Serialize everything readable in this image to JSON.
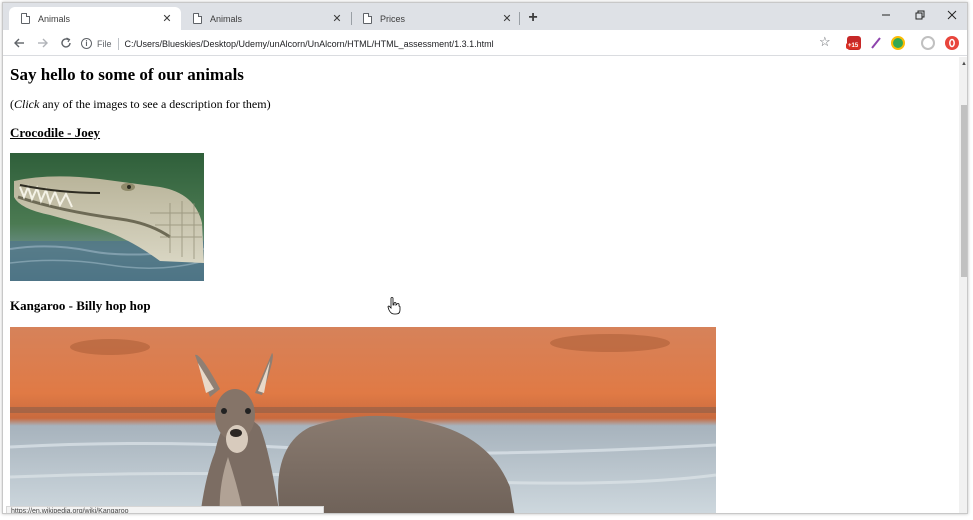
{
  "browser": {
    "tabs": [
      {
        "title": "Animals",
        "active": true
      },
      {
        "title": "Animals",
        "active": false
      },
      {
        "title": "Prices",
        "active": false
      }
    ],
    "address": {
      "scheme_label": "File",
      "url": "C:/Users/Blueskies/Desktop/Udemy/unAlcorn/UnAlcorn/HTML/HTML_assessment/1.3.1.html"
    },
    "extension_badge": "+15",
    "status_url": "https://en.wikipedia.org/wiki/Kangaroo"
  },
  "page": {
    "heading": "Say hello to some of our animals",
    "intro": {
      "open_paren": "(",
      "emphasis": "Click",
      "rest": " any of the images to see a description for them)"
    },
    "animals": [
      {
        "title": "Crocodile - Joey",
        "is_link": true,
        "image": "crocodile-photo"
      },
      {
        "title": "Kangaroo - Billy hop hop",
        "is_link": false,
        "image": "kangaroo-photo"
      }
    ]
  },
  "colors": {
    "tab_strip": "#dee1e6",
    "accent_red": "#d93025"
  }
}
